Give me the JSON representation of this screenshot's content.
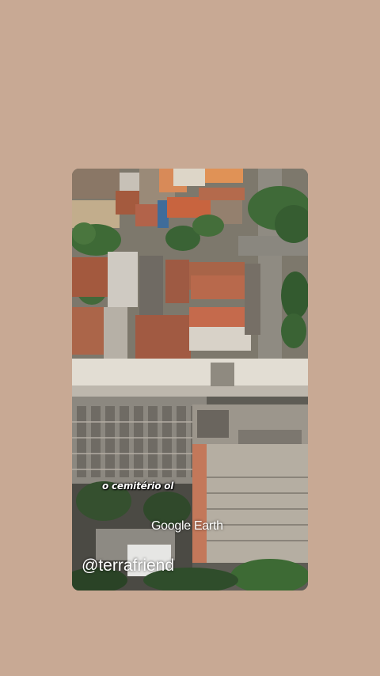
{
  "story": {
    "caption": "o cemitério ol",
    "watermark": "Google Earth",
    "handle": "@terrafriend"
  },
  "colors": {
    "page_background": "#c8a994",
    "text": "#ffffff"
  }
}
